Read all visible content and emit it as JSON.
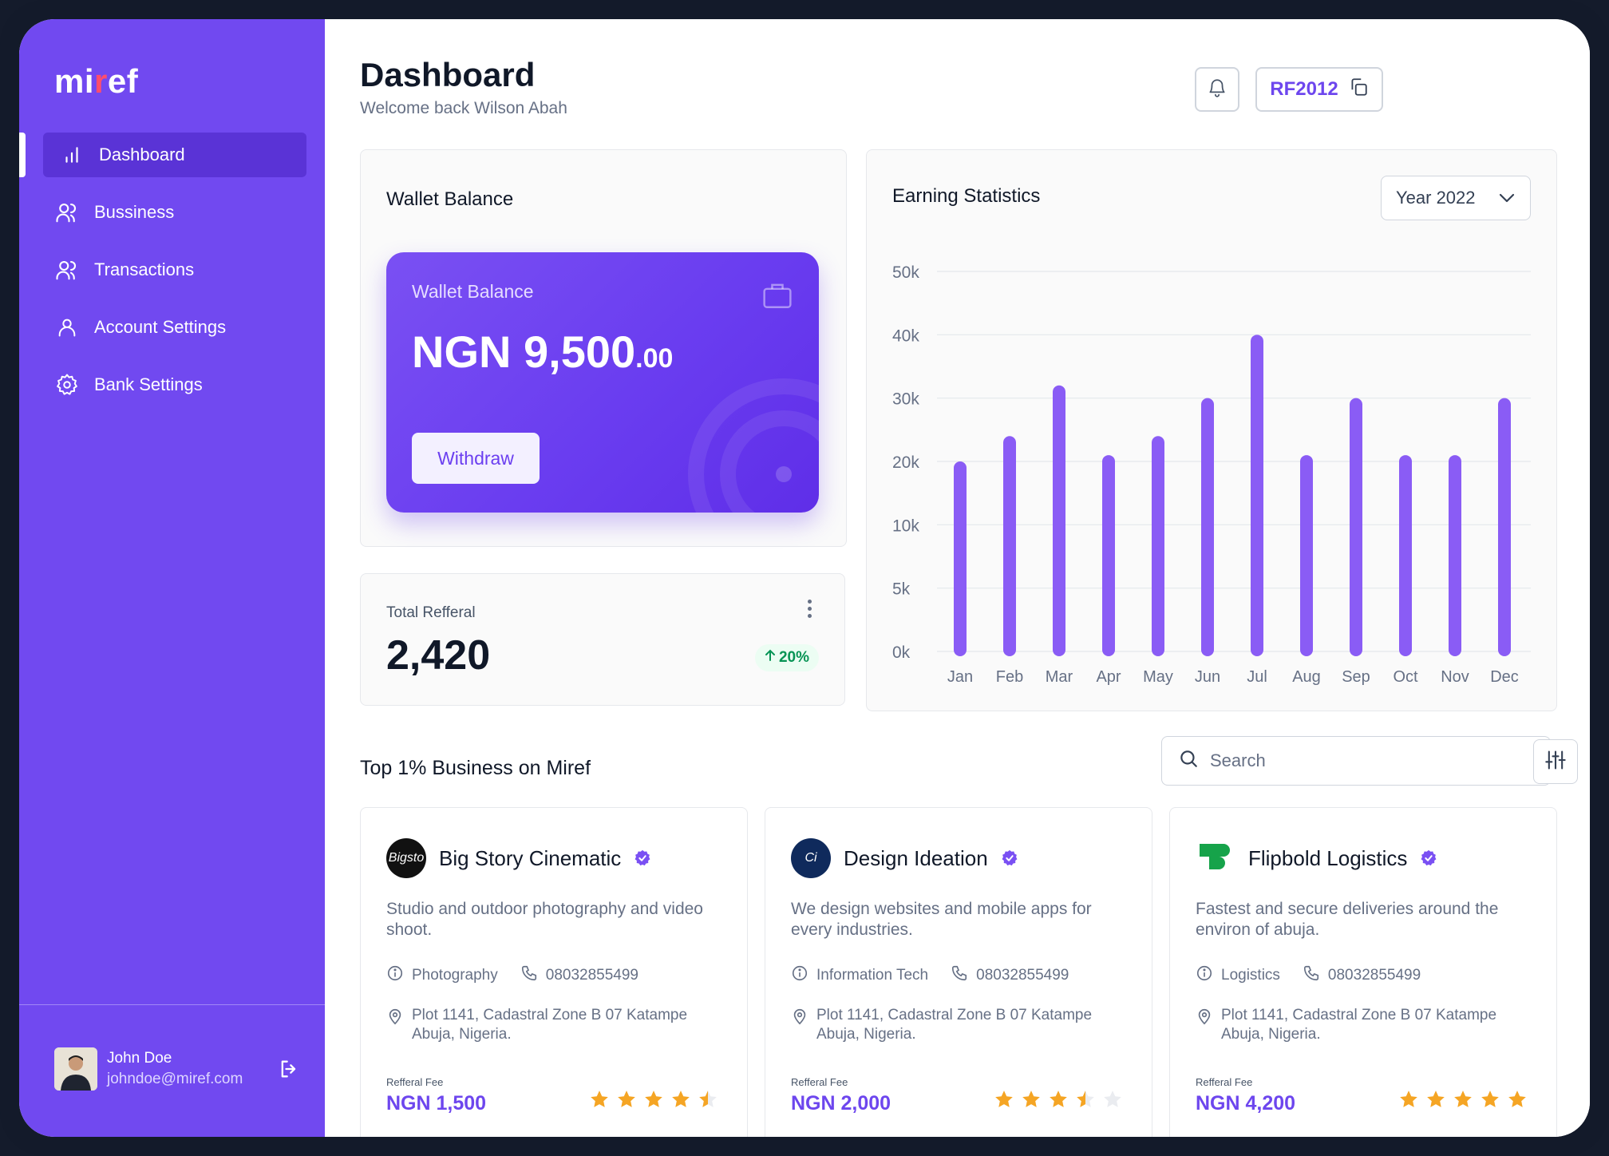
{
  "brand": {
    "logo_pre": "mi",
    "logo_accent": "r",
    "logo_post": "ef"
  },
  "sidebar": {
    "items": [
      {
        "label": "Dashboard",
        "icon": "bar-chart-icon",
        "active": true
      },
      {
        "label": "Bussiness",
        "icon": "users-icon",
        "active": false
      },
      {
        "label": "Transactions",
        "icon": "users-icon",
        "active": false
      },
      {
        "label": "Account Settings",
        "icon": "user-icon",
        "active": false
      },
      {
        "label": "Bank Settings",
        "icon": "gear-icon",
        "active": false
      }
    ],
    "user": {
      "name": "John Doe",
      "email": "johndoe@miref.com"
    }
  },
  "header": {
    "title": "Dashboard",
    "subtitle": "Welcome back Wilson Abah",
    "ref_code": "RF2012"
  },
  "wallet": {
    "section_title": "Wallet Balance",
    "card_label": "Wallet Balance",
    "amount_main": "NGN 9,500",
    "amount_cents": ".00",
    "withdraw_label": "Withdraw"
  },
  "referral": {
    "label": "Total Refferal",
    "value": "2,420",
    "change": "20%"
  },
  "stats": {
    "title": "Earning Statistics",
    "year_select": "Year 2022"
  },
  "chart_data": {
    "type": "bar",
    "categories": [
      "Jan",
      "Feb",
      "Mar",
      "Apr",
      "May",
      "Jun",
      "Jul",
      "Aug",
      "Sep",
      "Oct",
      "Nov",
      "Dec"
    ],
    "values": [
      20000,
      24000,
      32000,
      21000,
      24000,
      30000,
      40000,
      21000,
      30000,
      21000,
      21000,
      30000
    ],
    "yticks": [
      "0k",
      "5k",
      "10k",
      "20k",
      "30k",
      "40k",
      "50k"
    ],
    "title": "Earning Statistics",
    "color": "#8a5cf5",
    "grid": true
  },
  "businesses": {
    "title": "Top 1% Business on Miref",
    "search_placeholder": "Search",
    "fee_label": "Refferal Fee",
    "items": [
      {
        "name": "Big Story Cinematic",
        "logo_text": "Bigsto",
        "logo_bg": "#111111",
        "description": "Studio and outdoor photography and video shoot.",
        "category": "Photography",
        "phone": "08032855499",
        "address": "Plot 1141, Cadastral Zone B 07 Katampe Abuja, Nigeria.",
        "fee": "NGN 1,500",
        "rating": 4.5
      },
      {
        "name": "Design Ideation",
        "logo_text": "Ci",
        "logo_bg": "#0f2a5c",
        "description": "We design websites and mobile apps for every industries.",
        "category": "Information Tech",
        "phone": "08032855499",
        "address": "Plot 1141, Cadastral Zone B 07 Katampe Abuja, Nigeria.",
        "fee": "NGN 2,000",
        "rating": 3.5
      },
      {
        "name": "Flipbold Logistics",
        "logo_text": "",
        "logo_bg": "#16a34a",
        "description": "Fastest and secure deliveries around the environ of abuja.",
        "category": "Logistics",
        "phone": "08032855499",
        "address": "Plot 1141, Cadastral Zone B 07 Katampe Abuja, Nigeria.",
        "fee": "NGN 4,200",
        "rating": 5
      }
    ]
  },
  "colors": {
    "primary": "#7149f0",
    "accent": "#6d46ee",
    "star": "#f5a524",
    "positive": "#079455"
  }
}
